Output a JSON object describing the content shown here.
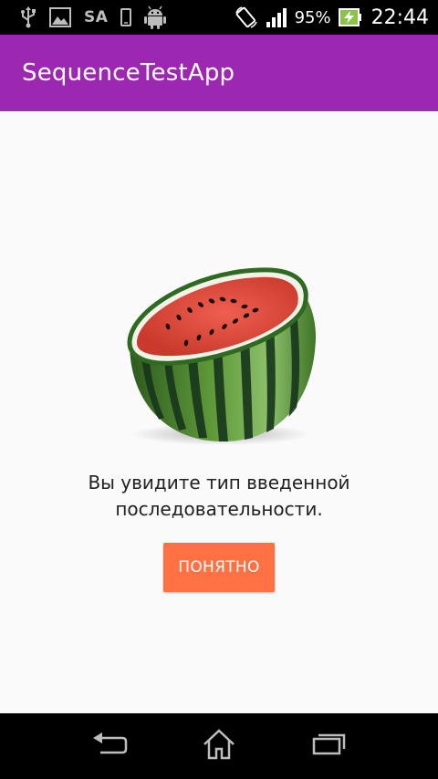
{
  "status_bar": {
    "carrier_text": "SA",
    "battery_percent": "95%",
    "time": "22:44",
    "icons": [
      "usb-icon",
      "image-icon",
      "phone-icon",
      "android-icon",
      "rotate-icon",
      "signal-icon",
      "battery-charging-icon"
    ]
  },
  "app_bar": {
    "title": "SequenceTestApp",
    "color": "#9c27b0"
  },
  "main": {
    "illustration": "watermelon-image",
    "message": "Вы увидите тип введенной последовательности.",
    "ok_button_label": "ПОНЯТНО",
    "ok_button_color": "#ff7043"
  },
  "nav_bar": {
    "icons": [
      "back-icon",
      "home-icon",
      "recents-icon"
    ]
  }
}
